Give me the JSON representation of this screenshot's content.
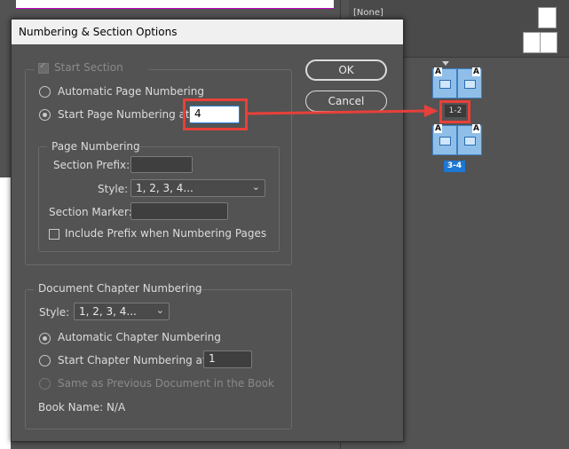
{
  "panel": {
    "master_none": "[None]",
    "spread1_label": "1-2",
    "spread2_label": "3-4",
    "master_letter": "A"
  },
  "dialog": {
    "title": "Numbering & Section Options",
    "start_section": "Start Section",
    "auto_page": "Automatic Page Numbering",
    "start_page": "Start Page Numbering at:",
    "start_page_value": "4",
    "page_numbering": {
      "legend": "Page Numbering",
      "section_prefix": "Section Prefix:",
      "section_prefix_value": "",
      "style_label": "Style:",
      "style_value": "1, 2, 3, 4...",
      "section_marker": "Section Marker:",
      "section_marker_value": "",
      "include_prefix": "Include Prefix when Numbering Pages"
    },
    "chapter": {
      "legend": "Document Chapter Numbering",
      "style_label": "Style:",
      "style_value": "1, 2, 3, 4...",
      "auto_chapter": "Automatic Chapter Numbering",
      "start_chapter": "Start Chapter Numbering at:",
      "start_chapter_value": "1",
      "same_as_prev": "Same as Previous Document in the Book",
      "book_name": "Book Name: N/A"
    },
    "ok": "OK",
    "cancel": "Cancel"
  },
  "colors": {
    "callout": "#e8403a",
    "focus": "#2a7fd6"
  }
}
